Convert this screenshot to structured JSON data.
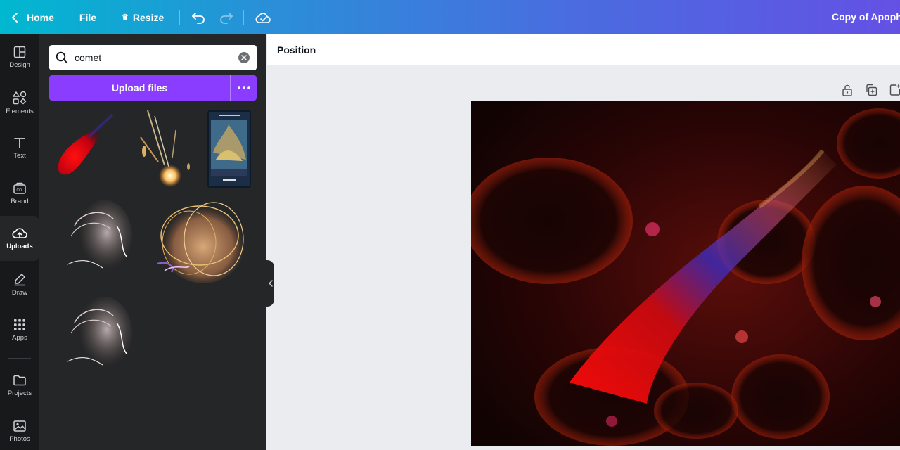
{
  "topbar": {
    "home_label": "Home",
    "file_label": "File",
    "resize_label": "Resize",
    "doc_title": "Copy of Apophy",
    "icons": [
      "chevron-left-icon",
      "crown-icon",
      "undo-icon",
      "redo-icon",
      "cloud-check-icon"
    ]
  },
  "rail": {
    "items": [
      {
        "label": "Design",
        "icon": "layout-icon"
      },
      {
        "label": "Elements",
        "icon": "shapes-icon"
      },
      {
        "label": "Text",
        "icon": "text-icon"
      },
      {
        "label": "Brand",
        "icon": "brand-kit-icon"
      },
      {
        "label": "Uploads",
        "icon": "cloud-upload-icon",
        "active": true
      },
      {
        "label": "Draw",
        "icon": "pen-icon"
      },
      {
        "label": "Apps",
        "icon": "grid-icon"
      },
      {
        "label": "Projects",
        "icon": "folder-icon"
      },
      {
        "label": "Photos",
        "icon": "image-icon"
      }
    ]
  },
  "panel": {
    "search_value": "comet",
    "upload_label": "Upload files",
    "thumbnails": [
      "red-comet-thumb",
      "sparks-comet-thumb",
      "book-cover-thumb",
      "white-swirl-thumb-1",
      "gold-rings-thumb",
      "white-swirl-thumb-2"
    ]
  },
  "editor": {
    "position_label": "Position",
    "page_tools": [
      "lock-icon",
      "duplicate-icon",
      "add-page-icon"
    ]
  },
  "colors": {
    "accent": "#8b3dff",
    "rail_bg": "#18191b",
    "panel_bg": "#252627",
    "topbar_start": "#00b8d0",
    "topbar_end": "#6451e4"
  }
}
